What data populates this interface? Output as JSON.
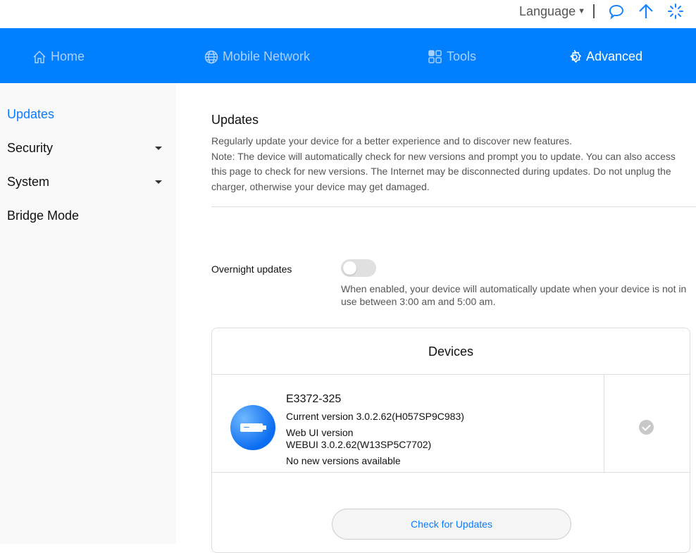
{
  "topbar": {
    "language_label": "Language",
    "icons": [
      "message-icon",
      "upload-arrow-icon",
      "loading-spinner-icon"
    ]
  },
  "nav": {
    "items": [
      {
        "label": "Home",
        "icon": "home-icon"
      },
      {
        "label": "Mobile Network",
        "icon": "globe-icon"
      },
      {
        "label": "Tools",
        "icon": "tools-grid-icon"
      },
      {
        "label": "Advanced",
        "icon": "gear-icon"
      }
    ],
    "active": "Advanced"
  },
  "sidebar": {
    "items": [
      {
        "label": "Updates"
      },
      {
        "label": "Security"
      },
      {
        "label": "System"
      },
      {
        "label": "Bridge Mode"
      }
    ]
  },
  "main": {
    "title": "Updates",
    "desc1": "Regularly update your device for a better experience and to discover new features.",
    "desc2": "Note: The device will automatically check for new versions and prompt you to update. You can also access this page to check for new versions. The Internet may be disconnected during updates. Do not unplug the charger, otherwise your device may get damaged.",
    "overnight_label": "Overnight updates",
    "overnight_enabled": false,
    "overnight_help": "When enabled, your device will automatically update when your device is not in use between 3:00 am and 5:00 am.",
    "devices": {
      "title": "Devices",
      "name": "E3372-325",
      "current_version": "Current version 3.0.2.62(H057SP9C983)",
      "webui_label": "Web UI version",
      "webui_version": "WEBUI 3.0.2.62(W13SP5C7702)",
      "status": "No new versions available",
      "check_button": "Check for Updates"
    }
  },
  "colors": {
    "accent": "#007fff",
    "link": "#0a7bff"
  }
}
